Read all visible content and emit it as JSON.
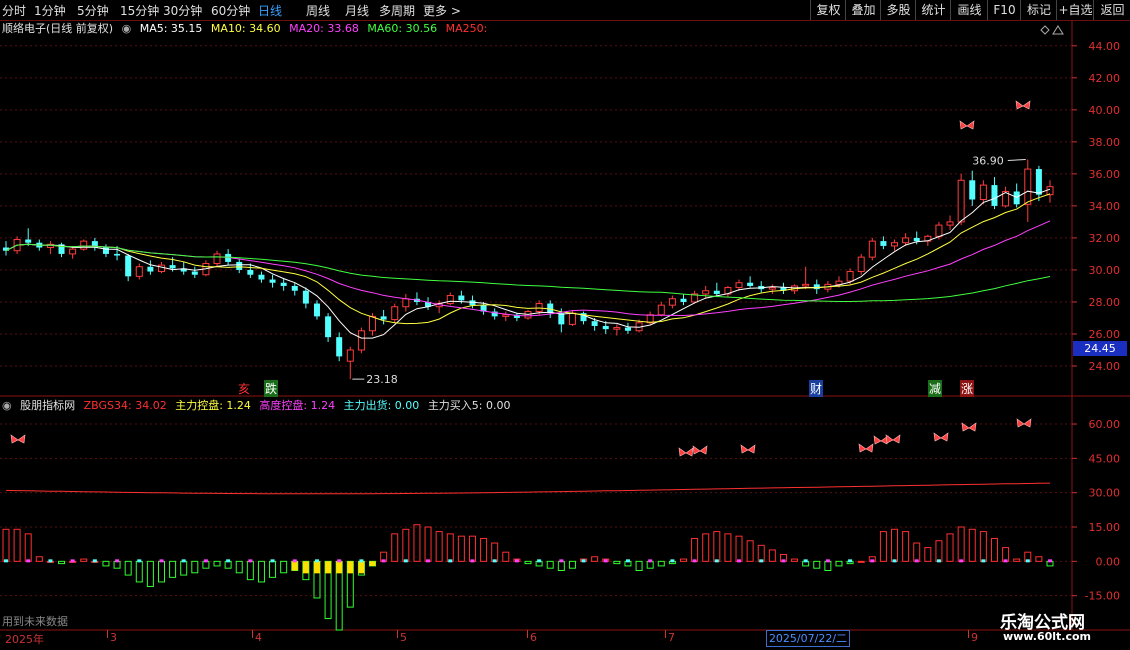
{
  "period_tabs": [
    "分时",
    "1分钟",
    "5分钟",
    "15分钟",
    "30分钟",
    "60分钟",
    "日线",
    "周线",
    "月线",
    "多周期",
    "更多 >"
  ],
  "active_tab": "日线",
  "toolbar": [
    "复权",
    "叠加",
    "多股",
    "统计",
    "画线",
    "F10",
    "标记",
    "+自选",
    "返回"
  ],
  "stock_title": "顺络电子(日线 前复权)",
  "ma": {
    "ma5": "MA5: 35.15",
    "ma10": "MA10: 34.60",
    "ma20": "MA20: 33.68",
    "ma60": "MA60: 30.56",
    "ma250": "MA250:"
  },
  "price_axis": [
    "44.00",
    "42.00",
    "40.00",
    "38.00",
    "36.00",
    "34.00",
    "32.00",
    "30.00",
    "28.00",
    "26.00",
    "24.00"
  ],
  "last_price": "24.45",
  "high_label": "36.90",
  "low_label": "23.18",
  "events": {
    "e1": "亥",
    "e2": "跌",
    "e3": "财",
    "e4": "减",
    "e5": "涨"
  },
  "indicator": {
    "name": "股朋指标网",
    "zbgs": "ZBGS34: 34.02",
    "zlkp": "主力控盘: 1.24",
    "gdkp": "高度控盘: 1.24",
    "zlch": "主力出货: 0.00",
    "zlmr": "主力买入5: 0.00"
  },
  "ind_axis": [
    "60.00",
    "45.00",
    "30.00",
    "15.00",
    "0.00",
    "-15.00"
  ],
  "footer_note": "用到未来数据",
  "date_labels": [
    "2025年",
    "3",
    "4",
    "5",
    "6",
    "7",
    "9"
  ],
  "cursor_date": "2025/07/22/二",
  "watermark": {
    "name": "乐淘公式网",
    "url": "www.60lt.com"
  },
  "colors": {
    "up": "#ff3c3c",
    "down": "#54ffff",
    "ma5": "#ffffff",
    "ma10": "#ffff40",
    "ma20": "#ff40ff",
    "ma60": "#40ff40",
    "ma250": "#ff3030"
  },
  "chart_data": {
    "type": "candlestick",
    "price_range": [
      23.0,
      44.8
    ],
    "ohlc": [
      [
        31.4,
        31.8,
        30.9,
        31.2
      ],
      [
        31.2,
        32.1,
        31.0,
        31.9
      ],
      [
        31.9,
        32.6,
        31.5,
        31.7
      ],
      [
        31.7,
        31.9,
        31.2,
        31.4
      ],
      [
        31.4,
        31.8,
        31.0,
        31.6
      ],
      [
        31.6,
        31.7,
        30.8,
        31.0
      ],
      [
        31.0,
        31.5,
        30.7,
        31.3
      ],
      [
        31.3,
        31.9,
        31.2,
        31.8
      ],
      [
        31.8,
        32.0,
        31.2,
        31.4
      ],
      [
        31.4,
        31.6,
        30.8,
        31.0
      ],
      [
        31.0,
        31.5,
        30.6,
        30.9
      ],
      [
        30.9,
        31.0,
        29.3,
        29.6
      ],
      [
        29.6,
        30.4,
        29.4,
        30.2
      ],
      [
        30.2,
        30.6,
        29.7,
        29.9
      ],
      [
        29.9,
        30.5,
        29.8,
        30.3
      ],
      [
        30.3,
        30.8,
        29.9,
        30.1
      ],
      [
        30.1,
        30.5,
        29.7,
        29.9
      ],
      [
        29.9,
        30.2,
        29.5,
        29.7
      ],
      [
        29.7,
        30.6,
        29.6,
        30.4
      ],
      [
        30.4,
        31.2,
        30.2,
        31.0
      ],
      [
        31.0,
        31.3,
        30.3,
        30.5
      ],
      [
        30.5,
        30.7,
        29.8,
        30.0
      ],
      [
        30.0,
        30.4,
        29.5,
        29.7
      ],
      [
        29.7,
        29.9,
        29.2,
        29.4
      ],
      [
        29.4,
        29.7,
        28.9,
        29.2
      ],
      [
        29.2,
        29.5,
        28.7,
        29.0
      ],
      [
        29.0,
        29.2,
        28.4,
        28.7
      ],
      [
        28.7,
        28.9,
        27.6,
        27.9
      ],
      [
        27.9,
        28.1,
        26.9,
        27.1
      ],
      [
        27.1,
        27.3,
        25.5,
        25.8
      ],
      [
        25.8,
        26.1,
        24.3,
        24.6
      ],
      [
        24.3,
        25.2,
        23.18,
        25.0
      ],
      [
        25.0,
        26.4,
        24.8,
        26.2
      ],
      [
        26.2,
        27.3,
        25.9,
        27.1
      ],
      [
        27.1,
        27.5,
        26.6,
        26.9
      ],
      [
        26.9,
        27.9,
        26.7,
        27.7
      ],
      [
        27.7,
        28.5,
        27.4,
        28.2
      ],
      [
        28.2,
        28.6,
        27.8,
        28.0
      ],
      [
        28.0,
        28.3,
        27.5,
        27.7
      ],
      [
        27.7,
        28.1,
        27.3,
        27.9
      ],
      [
        27.9,
        28.6,
        27.8,
        28.4
      ],
      [
        28.4,
        28.7,
        27.9,
        28.1
      ],
      [
        28.1,
        28.4,
        27.6,
        27.8
      ],
      [
        27.8,
        28.0,
        27.2,
        27.4
      ],
      [
        27.4,
        27.6,
        26.9,
        27.1
      ],
      [
        27.1,
        27.4,
        26.8,
        27.2
      ],
      [
        27.2,
        27.3,
        26.8,
        27.0
      ],
      [
        27.0,
        27.5,
        26.9,
        27.4
      ],
      [
        27.4,
        28.1,
        27.2,
        27.9
      ],
      [
        27.9,
        28.1,
        27.0,
        27.3
      ],
      [
        27.3,
        27.6,
        26.1,
        26.6
      ],
      [
        26.6,
        27.5,
        26.5,
        27.3
      ],
      [
        27.3,
        27.4,
        26.6,
        26.8
      ],
      [
        26.8,
        27.0,
        26.2,
        26.5
      ],
      [
        26.5,
        26.8,
        26.0,
        26.3
      ],
      [
        26.3,
        26.6,
        25.9,
        26.4
      ],
      [
        26.4,
        26.7,
        26.0,
        26.2
      ],
      [
        26.2,
        26.9,
        26.1,
        26.7
      ],
      [
        26.7,
        27.4,
        26.6,
        27.2
      ],
      [
        27.2,
        28.0,
        27.1,
        27.8
      ],
      [
        27.8,
        28.4,
        27.6,
        28.2
      ],
      [
        28.2,
        28.5,
        27.8,
        28.0
      ],
      [
        28.0,
        28.7,
        27.9,
        28.5
      ],
      [
        28.5,
        29.0,
        28.2,
        28.7
      ],
      [
        28.7,
        29.2,
        28.3,
        28.5
      ],
      [
        28.5,
        29.0,
        28.3,
        28.9
      ],
      [
        28.9,
        29.4,
        28.7,
        29.2
      ],
      [
        29.2,
        29.6,
        28.9,
        29.0
      ],
      [
        29.0,
        29.3,
        28.6,
        28.8
      ],
      [
        28.8,
        29.1,
        28.5,
        28.9
      ],
      [
        28.9,
        29.2,
        28.5,
        28.7
      ],
      [
        28.7,
        29.1,
        28.5,
        29.0
      ],
      [
        29.0,
        30.2,
        28.8,
        29.1
      ],
      [
        29.1,
        29.4,
        28.5,
        28.8
      ],
      [
        28.8,
        29.3,
        28.6,
        29.1
      ],
      [
        29.1,
        29.6,
        28.9,
        29.3
      ],
      [
        29.3,
        30.1,
        29.1,
        29.9
      ],
      [
        29.9,
        31.0,
        29.7,
        30.8
      ],
      [
        30.8,
        32.0,
        30.6,
        31.8
      ],
      [
        31.8,
        32.1,
        31.3,
        31.5
      ],
      [
        31.5,
        31.9,
        31.2,
        31.7
      ],
      [
        31.7,
        32.3,
        31.5,
        32.0
      ],
      [
        32.0,
        32.4,
        31.6,
        31.8
      ],
      [
        31.8,
        32.2,
        31.5,
        32.1
      ],
      [
        32.1,
        33.0,
        31.9,
        32.8
      ],
      [
        32.8,
        33.4,
        32.5,
        33.0
      ],
      [
        33.0,
        36.0,
        32.8,
        35.6
      ],
      [
        35.6,
        36.2,
        34.0,
        34.4
      ],
      [
        34.4,
        35.6,
        34.1,
        35.3
      ],
      [
        35.3,
        35.8,
        33.8,
        34.0
      ],
      [
        34.0,
        35.2,
        33.9,
        34.9
      ],
      [
        34.9,
        35.4,
        33.9,
        34.1
      ],
      [
        34.1,
        36.9,
        33.0,
        36.3
      ],
      [
        36.3,
        36.5,
        34.3,
        34.7
      ],
      [
        34.7,
        35.6,
        34.2,
        35.2
      ]
    ],
    "histogram": [
      14,
      14,
      12,
      2,
      0,
      -1,
      0,
      1,
      0,
      -2,
      -3,
      -6,
      -9,
      -11,
      -9,
      -7,
      -6,
      -5,
      -3,
      -2,
      -3,
      -5,
      -8,
      -9,
      -7,
      -5,
      -4,
      -8,
      -16,
      -25,
      -30,
      -20,
      -6,
      -2,
      4,
      12,
      14,
      16,
      15,
      13,
      12,
      11,
      11,
      10,
      8,
      4,
      1,
      -1,
      -2,
      -3,
      -4,
      -3,
      1,
      2,
      1,
      -1,
      -2,
      -4,
      -3,
      -2,
      -1,
      1,
      10,
      12,
      13,
      12,
      11,
      9,
      7,
      5,
      3,
      1,
      -2,
      -3,
      -4,
      -2,
      -1,
      0,
      2,
      13,
      14,
      13,
      8,
      6,
      9,
      12,
      15,
      14,
      13,
      10,
      6,
      1,
      4,
      2,
      -2
    ],
    "ind_range": [
      -30,
      67
    ]
  }
}
